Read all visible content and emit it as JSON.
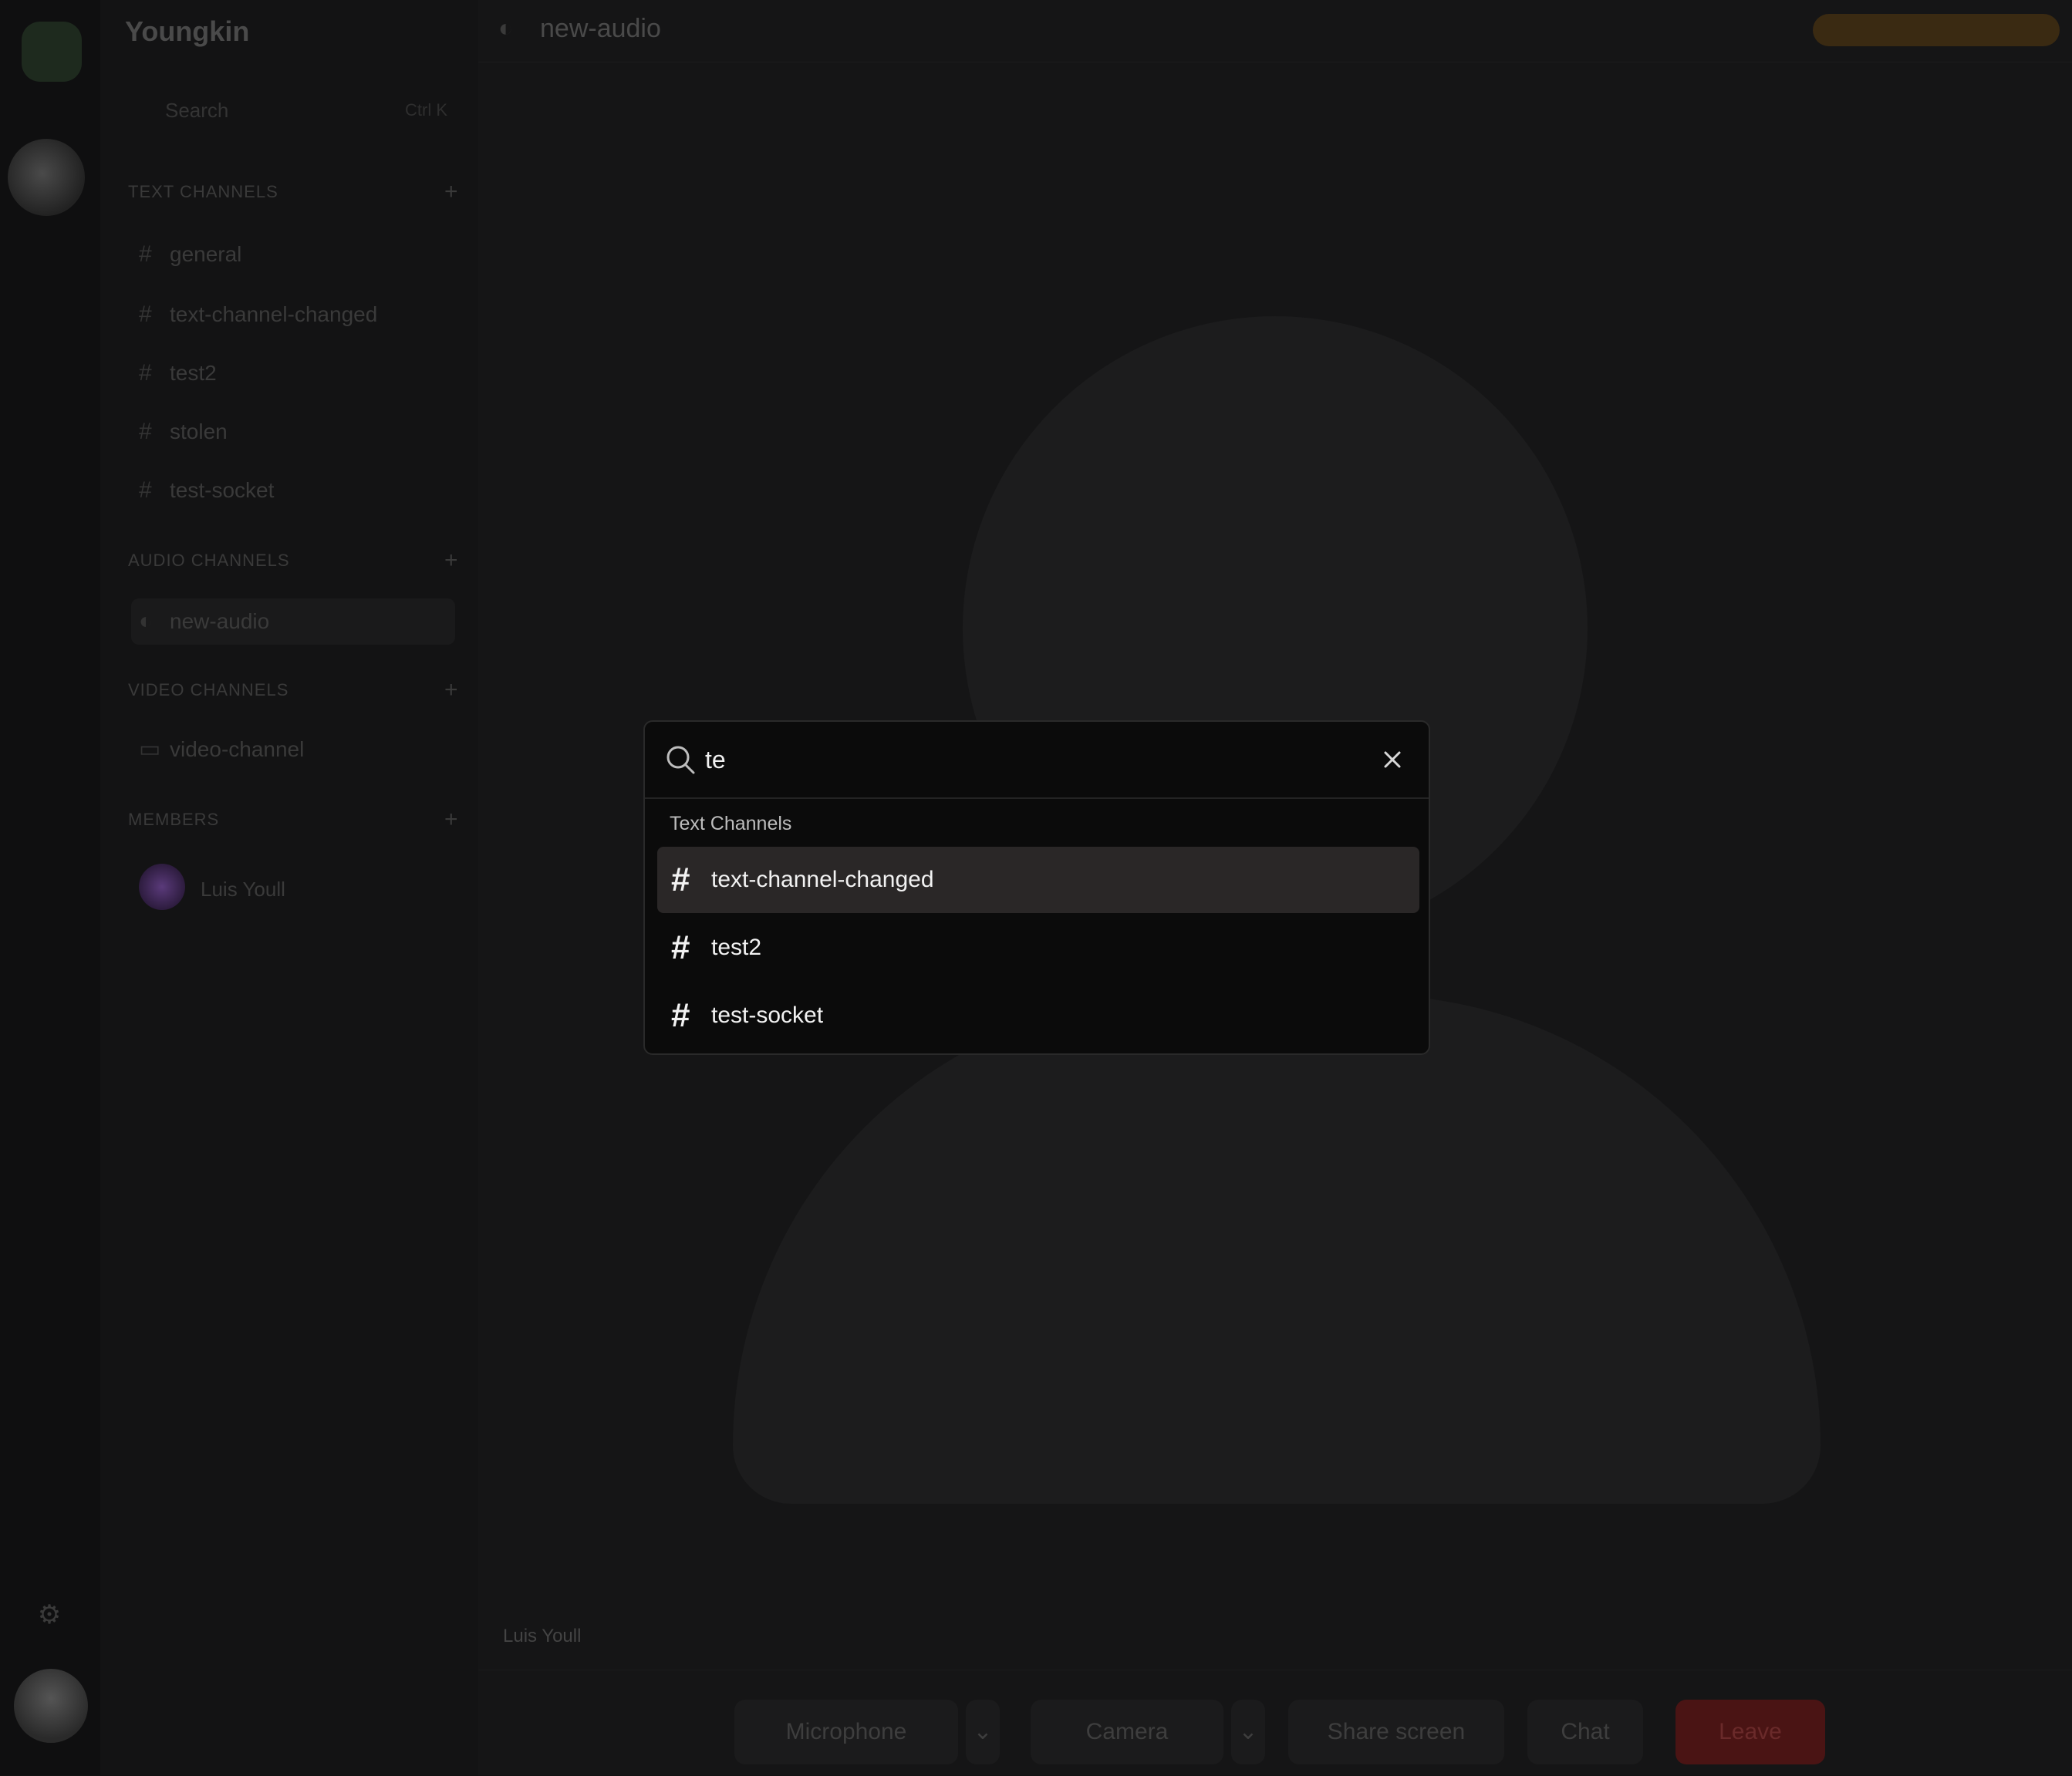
{
  "background": {
    "server_name": "Youngkin",
    "sidebar_search_placeholder": "Search",
    "sidebar_search_hint": "Ctrl K",
    "categories": [
      {
        "label": "TEXT CHANNELS"
      },
      {
        "label": "AUDIO CHANNELS"
      },
      {
        "label": "VIDEO CHANNELS"
      },
      {
        "label": "MEMBERS"
      }
    ],
    "text_channels": [
      "general",
      "text-channel-changed",
      "test2",
      "stolen",
      "test-socket"
    ],
    "audio_channels": [
      "new-audio"
    ],
    "video_channels": [
      "video-channel"
    ],
    "members": [
      "Luis Youll"
    ],
    "topbar_title": "new-audio",
    "participant_name": "Luis Youll",
    "controls": [
      "Microphone",
      "Camera",
      "Share screen",
      "Chat",
      "Leave"
    ]
  },
  "search_modal": {
    "query": "te",
    "group_label": "Text Channels",
    "results": [
      {
        "label": "text-channel-changed",
        "selected": true
      },
      {
        "label": "test2",
        "selected": false
      },
      {
        "label": "test-socket",
        "selected": false
      }
    ]
  },
  "colors": {
    "modal_bg": "#0b0b0b",
    "selected_row": "#2a2727",
    "backdrop": "#111112"
  },
  "icons": {
    "search": "search-icon",
    "close": "close-icon",
    "channel": "hash-icon"
  }
}
